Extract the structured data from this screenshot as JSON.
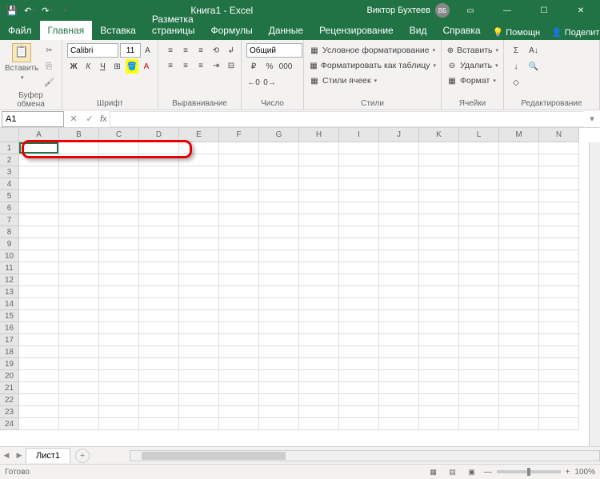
{
  "title": {
    "doc": "Книга1",
    "app": "Excel",
    "user": "Виктор Бухтеев",
    "avatar": "ВБ"
  },
  "tabs": {
    "file": "Файл",
    "items": [
      "Главная",
      "Вставка",
      "Разметка страницы",
      "Формулы",
      "Данные",
      "Рецензирование",
      "Вид",
      "Справка"
    ],
    "help": "Помощн",
    "share": "Поделиться"
  },
  "ribbon": {
    "clipboard": {
      "paste": "Вставить",
      "label": "Буфер обмена"
    },
    "font": {
      "name": "Calibri",
      "size": "11",
      "label": "Шрифт"
    },
    "align": {
      "label": "Выравнивание"
    },
    "number": {
      "format": "Общий",
      "label": "Число"
    },
    "styles": {
      "cond": "Условное форматирование",
      "table": "Форматировать как таблицу",
      "cell": "Стили ячеек",
      "label": "Стили"
    },
    "cells": {
      "insert": "Вставить",
      "delete": "Удалить",
      "format": "Формат",
      "label": "Ячейки"
    },
    "edit": {
      "label": "Редактирование"
    }
  },
  "namebox": "A1",
  "cols": [
    "A",
    "B",
    "C",
    "D",
    "E",
    "F",
    "G",
    "H",
    "I",
    "J",
    "K",
    "L",
    "M",
    "N"
  ],
  "rows": [
    "1",
    "2",
    "3",
    "4",
    "5",
    "6",
    "7",
    "8",
    "9",
    "10",
    "11",
    "12",
    "13",
    "14",
    "15",
    "16",
    "17",
    "18",
    "19",
    "20",
    "21",
    "22",
    "23",
    "24"
  ],
  "sheet": "Лист1",
  "status": {
    "ready": "Готово",
    "zoom": "100%"
  }
}
